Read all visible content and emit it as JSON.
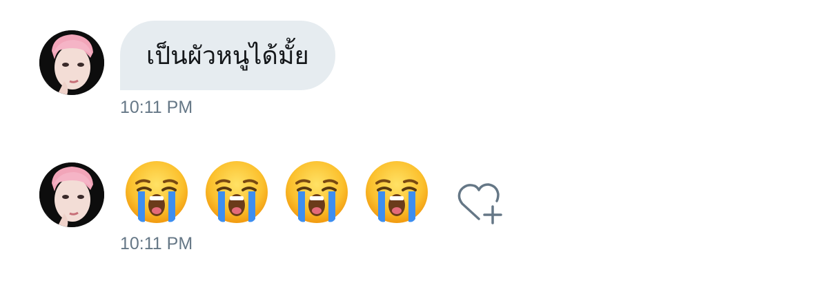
{
  "messages": [
    {
      "text": "เป็นผัวหนูได้มั้ย",
      "time": "10:11 PM"
    },
    {
      "emojis": [
        "loudly-crying-face",
        "loudly-crying-face",
        "loudly-crying-face",
        "loudly-crying-face"
      ],
      "time": "10:11 PM"
    }
  ],
  "icons": {
    "react": "heart-plus-icon"
  },
  "colors": {
    "bubble_bg": "#e6ecf0",
    "timestamp": "#657786",
    "text": "#14171a",
    "icon": "#657786"
  }
}
